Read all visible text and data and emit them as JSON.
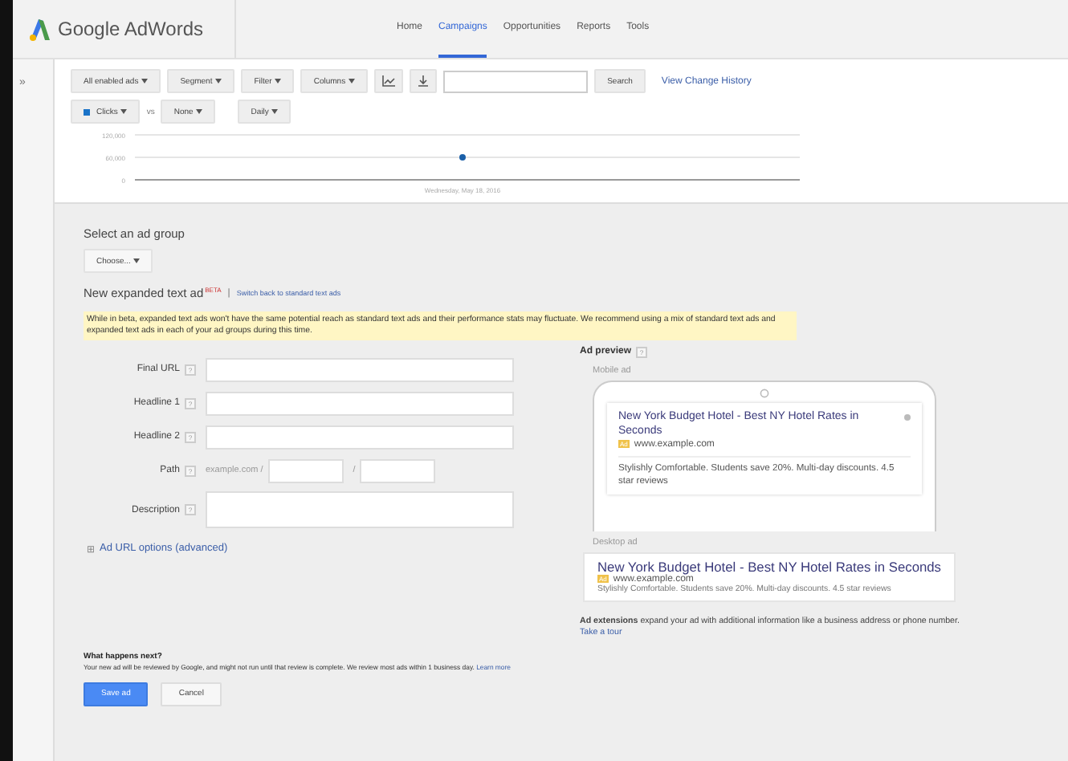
{
  "header": {
    "logo": "Google AdWords",
    "nav": [
      {
        "label": "Home",
        "selected": false
      },
      {
        "label": "Campaigns",
        "selected": true
      },
      {
        "label": "Opportunities",
        "selected": false
      },
      {
        "label": "Reports",
        "selected": false
      },
      {
        "label": "Tools",
        "selected": false
      }
    ]
  },
  "sidebar_toggle": "»",
  "toolbar": {
    "filters": [
      "All enabled ads",
      "Segment",
      "Filter",
      "Columns"
    ],
    "search_button": "Search",
    "history_link": "View Change History"
  },
  "chart_controls": {
    "metric": {
      "color": "#1a73c8"
    },
    "vs": "vs",
    "compare": "None",
    "period": "Daily"
  },
  "chart": {
    "chart_data": {
      "type": "line",
      "x": [
        "Wednesday, May 18, 2016"
      ],
      "series": [
        {
          "name": "Clicks",
          "color": "#1a5fa8",
          "marker": "circle",
          "values": [
            60000
          ]
        }
      ],
      "ylim": [
        0,
        120000
      ],
      "yticks": [
        {
          "value": 0,
          "label": "0"
        },
        {
          "value": 60000,
          "label": "60,000"
        },
        {
          "value": 120000,
          "label": "120,000"
        }
      ]
    }
  },
  "form": {
    "select_label": "Select an ad group",
    "select_button": "Choose...",
    "ad_type": "New expanded text ad",
    "badge": "BETA",
    "separator": "|",
    "switch_link": "Switch back to standard text ads",
    "notice": "While in beta, expanded text ads won't have the same potential reach as standard text ads and their performance stats may fluctuate. We recommend using a mix of standard text ads and expanded text ads in each of your ad groups during this time.",
    "fields": [
      {
        "label": "Final URL",
        "help": "?",
        "kind": "text"
      },
      {
        "label": "Headline 1",
        "help": "?",
        "kind": "text"
      },
      {
        "label": "Headline 2",
        "help": "?",
        "kind": "text"
      },
      {
        "label": "Path",
        "help": "?",
        "kind": "path",
        "prefix": "example.com /",
        "separator": "/"
      },
      {
        "label": "Description",
        "help": "?",
        "kind": "textarea"
      }
    ],
    "url_options": {
      "icon": "⊞",
      "label": "Ad URL options (advanced)"
    }
  },
  "preview": {
    "title": "Ad preview",
    "help": "?",
    "mobile_label": "Mobile ad",
    "mobile_ad": {
      "headline": "New York Budget Hotel - Best NY Hotel Rates in Seconds",
      "badge": "Ad",
      "url": "www.example.com",
      "description": "Stylishly Comfortable. Students save 20%. Multi-day discounts. 4.5 star reviews"
    },
    "desktop_label": "Desktop ad",
    "desktop_ad": {
      "headline": "New York Budget Hotel - Best NY Hotel Rates in Seconds",
      "badge": "Ad",
      "url": "www.example.com",
      "description": "Stylishly Comfortable. Students save 20%. Multi-day discounts. 4.5 star reviews"
    },
    "extensions": "**Ad extensions** expand your ad with additional information like a business address or phone number.",
    "tour_link": "Take a tour"
  },
  "next": {
    "title": "What happens next?",
    "text": "Your new ad will be reviewed by Google, and might not run until that review is complete. We review most ads within 1 business day.",
    "link": "Learn more"
  },
  "buttons": [
    {
      "label": "Save ad",
      "kind": "primary"
    },
    {
      "label": "Cancel",
      "kind": "secondary"
    }
  ]
}
